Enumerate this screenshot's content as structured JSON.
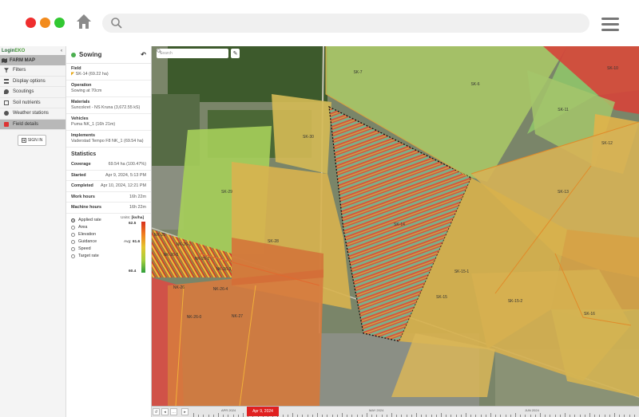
{
  "app": {
    "logo_prefix": "Login",
    "logo_suffix": "EKO",
    "farm_map": "FARM MAP",
    "nav": [
      {
        "label": "Filters",
        "icon": "filter-icon"
      },
      {
        "label": "Display options",
        "icon": "layers-icon"
      },
      {
        "label": "Scoutings",
        "icon": "scouting-icon"
      },
      {
        "label": "Soil nutrients",
        "icon": "soil-icon"
      },
      {
        "label": "Weather stations",
        "icon": "weather-icon"
      },
      {
        "label": "Field details",
        "icon": "field-icon"
      }
    ],
    "sign_in": "SIGN IN"
  },
  "panel": {
    "title": "Sowing",
    "field_label": "Field",
    "field_value": "SK-14 (69.22 ha)",
    "operation_label": "Operation",
    "operation_value": "Sowing at 70cm",
    "materials_label": "Materials",
    "materials_value": "Suncokret - NS Kruna (3,672.55 kS)",
    "vehicles_label": "Vehicles",
    "vehicles_value": "Puma NK_1 (16h 21m)",
    "implements_label": "Implements",
    "implements_value": "Vaderstad Tempo F8 NK_1 (69.54 ha)",
    "statistics_title": "Statistics",
    "stats": [
      {
        "k": "Coverage",
        "v": "69.54 ha (100.47%)"
      },
      {
        "k": "Started",
        "v": "Apr 9, 2024, 5:13 PM"
      },
      {
        "k": "Completed",
        "v": "Apr 10, 2024, 12:21 PM"
      },
      {
        "k": "Work hours",
        "v": "16h 22m"
      },
      {
        "k": "Machine hours",
        "v": "16h 22m"
      }
    ],
    "radios": [
      "Applied rate",
      "Area",
      "Elevation",
      "Guidance",
      "Speed",
      "Target rate"
    ],
    "units_label": "Units:",
    "units_value": "[ks/ha]",
    "scale_max": "62.5",
    "avg_label": "Avg:",
    "avg_value": "61.6",
    "scale_min": "60.4"
  },
  "map": {
    "search_placeholder": "Search",
    "fields": [
      "SK-7",
      "SK-6",
      "SK-10",
      "SK-11",
      "SK-12",
      "SK-30",
      "SK-29",
      "SK-13",
      "SK-28",
      "SK-14",
      "SK-15-1",
      "SK-15",
      "SK-15-2",
      "SK-16",
      "NK-25",
      "NK-26-5",
      "NK-26-1",
      "NK-26-2",
      "NK-26-3",
      "NK-26-4",
      "NK-26",
      "NK-26-0",
      "NK-27"
    ]
  },
  "timeline": {
    "current": "Apr 9, 2024",
    "labels": [
      "APR 2024",
      "MAY 2024",
      "JUN 2024"
    ]
  }
}
